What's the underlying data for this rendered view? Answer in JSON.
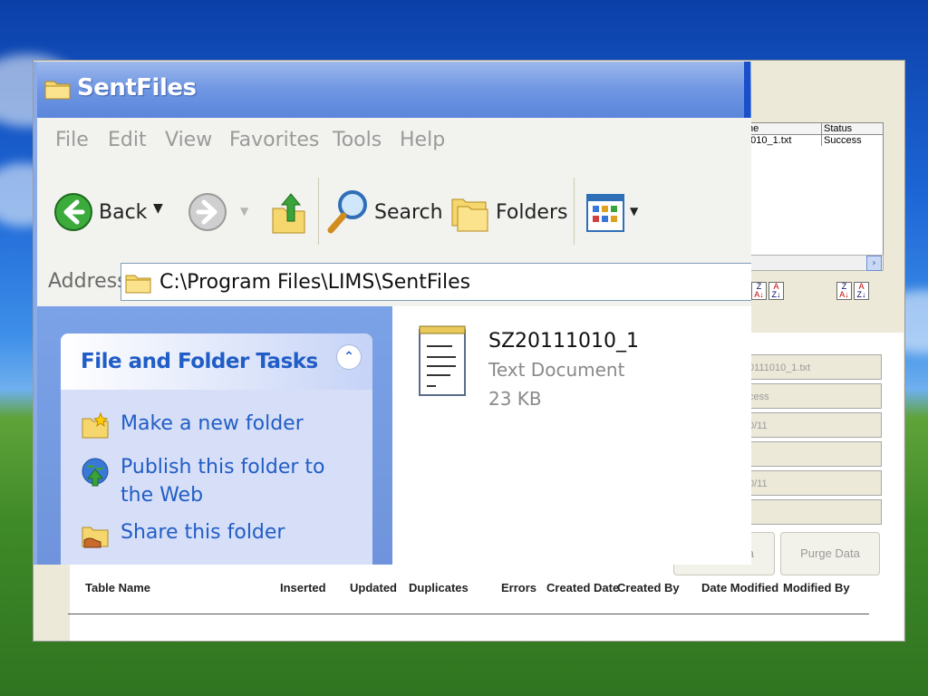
{
  "background_window": {
    "list_headers": [
      "me",
      "Status"
    ],
    "list_rows": [
      [
        "1010_1.txt",
        "Success"
      ]
    ],
    "fields": [
      "0111010_1.txt",
      "cess",
      "0/11",
      "",
      "0/11",
      ""
    ],
    "buttons": {
      "partial_label": "a",
      "purge_label": "Purge Data"
    },
    "table_headers": {
      "table_name": "Table Name",
      "inserted": "Inserted",
      "updated": "Updated",
      "duplicates": "Duplicates",
      "errors": "Errors",
      "created_date": "Created Date",
      "created_by": "Created By",
      "date_modified": "Date Modified",
      "modified_by": "Modified By"
    }
  },
  "explorer": {
    "title": "SentFiles",
    "menu": [
      "File",
      "Edit",
      "View",
      "Favorites",
      "Tools",
      "Help"
    ],
    "toolbar": {
      "back": "Back",
      "search": "Search",
      "folders": "Folders"
    },
    "address_label": "Address",
    "address_path": "C:\\Program Files\\LIMS\\SentFiles",
    "tasks": {
      "header": "File and Folder Tasks",
      "items": [
        "Make a new folder",
        "Publish this folder to the Web",
        "Share this folder"
      ]
    },
    "file": {
      "name": "SZ20111010_1",
      "type": "Text Document",
      "size": "23 KB"
    }
  },
  "colors": {
    "title_bar": "#6f96e3",
    "task_link": "#215dc6",
    "task_pane": "#7ba2e7"
  },
  "icons": [
    "folder-icon",
    "back-arrow-icon",
    "forward-arrow-icon",
    "up-folder-icon",
    "search-icon",
    "folders-icon",
    "views-icon",
    "collapse-chevron-icon",
    "new-folder-icon",
    "publish-web-icon",
    "share-folder-icon",
    "notepad-file-icon"
  ]
}
